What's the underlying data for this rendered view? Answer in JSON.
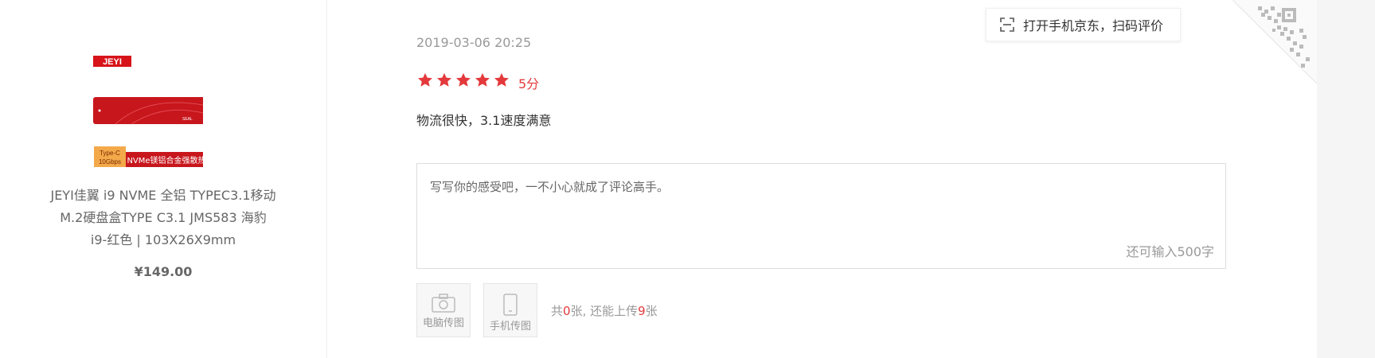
{
  "product": {
    "brand_logo": "JEYI",
    "image_badge_top": "Type-C",
    "image_badge_bottom": "10Gbps",
    "image_banner_text": "NVMe镁铝合金强散热",
    "image_device_text": "SEAL",
    "title_lines": [
      "JEYI佳翼 i9 NVME 全铝 TYPEC3.1移动",
      "M.2硬盘盒TYPE C3.1 JMS583 海豹",
      "i9-红色 | 103X26X9mm"
    ],
    "price": "¥149.00"
  },
  "review": {
    "timestamp": "2019-03-06 20:25",
    "rating": 5,
    "score_label": "5分",
    "comment": "物流很快，3.1速度满意"
  },
  "editor": {
    "placeholder": "写写你的感受吧，一不小心就成了评论高手。",
    "char_count": "还可输入500字"
  },
  "upload": {
    "pc_label": "电脑传图",
    "mobile_label": "手机传图",
    "hint_prefix": "共",
    "uploaded_count": "0",
    "hint_middle": "张, 还能上传",
    "remaining_count": "9",
    "hint_suffix": "张"
  },
  "qr": {
    "tooltip_text": "打开手机京东，扫码评价"
  },
  "colors": {
    "accent_red": "#e4393c",
    "logo_red": "#d7141a",
    "text_gray": "#999999"
  }
}
